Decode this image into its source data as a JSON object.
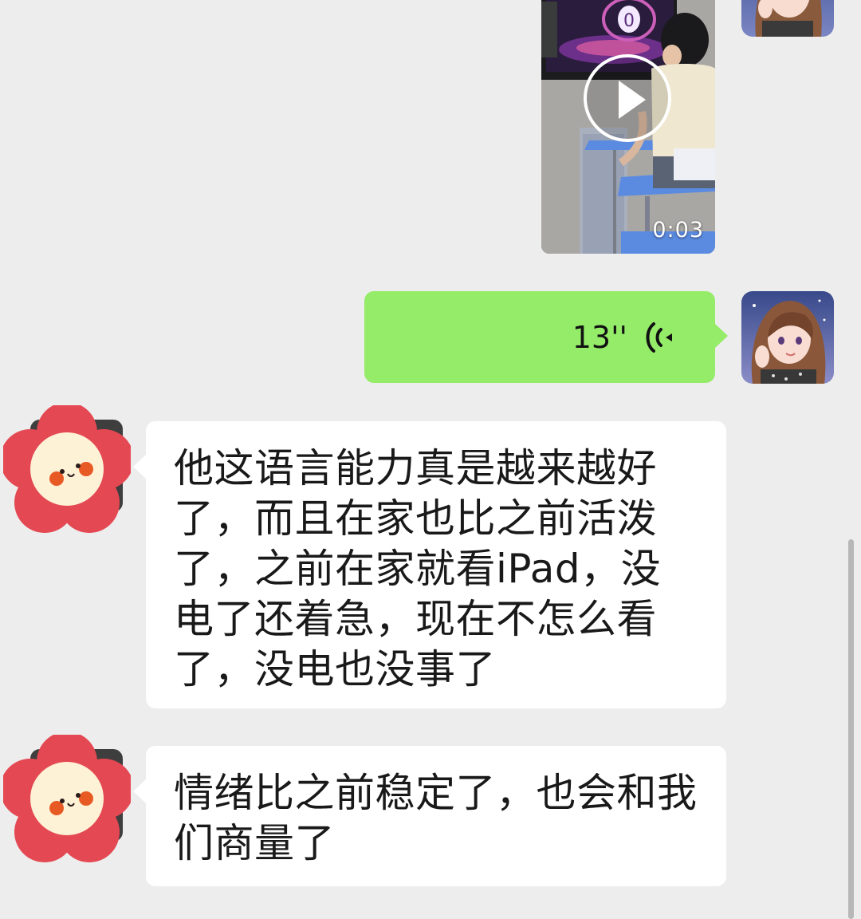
{
  "messages": [
    {
      "type": "video",
      "sender": "self",
      "duration": "0:03",
      "screen_counter": "0"
    },
    {
      "type": "voice",
      "sender": "self",
      "duration": "13''"
    },
    {
      "type": "text",
      "sender": "peer",
      "text": "他这语言能力真是越来越好了，而且在家也比之前活泼了，之前在家就看iPad，没电了还着急，现在不怎么看了，没电也没事了"
    },
    {
      "type": "text",
      "sender": "peer",
      "text": "情绪比之前稳定了，也会和我们商量了"
    }
  ],
  "icons": {
    "play": "play-icon",
    "voice": "voice-wave-icon",
    "self_avatar": "illustrated-girl-avatar",
    "peer_avatar": "red-flower-avatar"
  },
  "colors": {
    "chat_background": "#ededed",
    "self_bubble": "#95ec69",
    "peer_bubble": "#ffffff",
    "avatar_flower_red": "#e44852"
  }
}
